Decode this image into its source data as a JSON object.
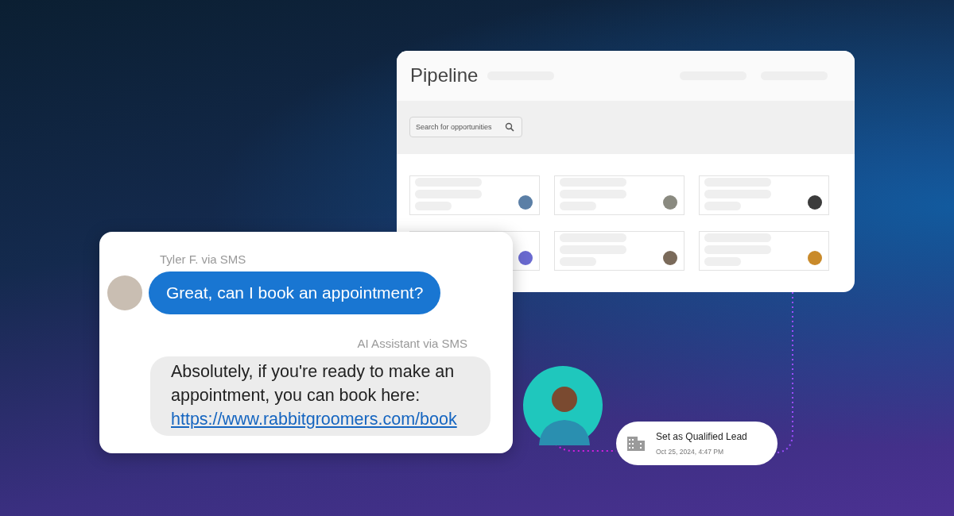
{
  "pipeline": {
    "title": "Pipeline",
    "search": {
      "placeholder": "Search for opportunities"
    }
  },
  "chat": {
    "messages": [
      {
        "kind": "incoming",
        "sender": "Tyler F. via SMS",
        "text": "Great, can I book an appointment?"
      },
      {
        "kind": "outgoing",
        "sender": "AI Assistant via SMS",
        "text": "Absolutely, if you're ready to make an appointment, you can book here:",
        "link": "https://www.rabbitgroomers.com/book"
      }
    ]
  },
  "event": {
    "title": "Set as Qualified Lead",
    "time": "Oct 25, 2024, 4:47 PM"
  }
}
